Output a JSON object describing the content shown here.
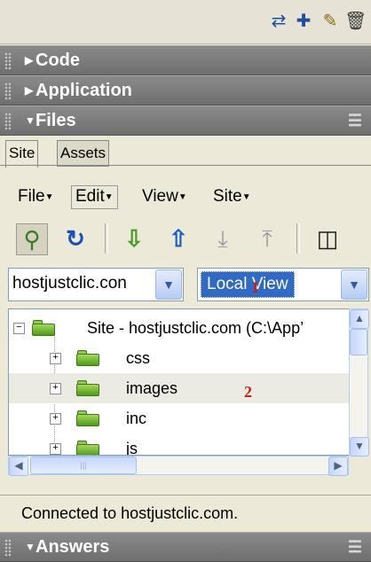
{
  "toolbar_icons": [
    "connect-icon",
    "new-file-icon",
    "edit-icon",
    "delete-icon"
  ],
  "panels": {
    "code": "Code",
    "application": "Application",
    "files": "Files",
    "answers": "Answers"
  },
  "tabs": [
    "Site",
    "Assets"
  ],
  "menus": [
    "File",
    "Edit",
    "View",
    "Site"
  ],
  "site_select": "hostjustclic.con",
  "view_select": "Local View",
  "tree": {
    "root": "Site - hostjustclic.com (C:\\App’",
    "folders": [
      "css",
      "images",
      "inc",
      "js"
    ]
  },
  "annotations": [
    "1",
    "2"
  ],
  "status": "Connected to hostjustclic.com.",
  "colors": {
    "folder": "#5aa820",
    "annotation": "#c8201a",
    "selection": "#316ac5"
  }
}
